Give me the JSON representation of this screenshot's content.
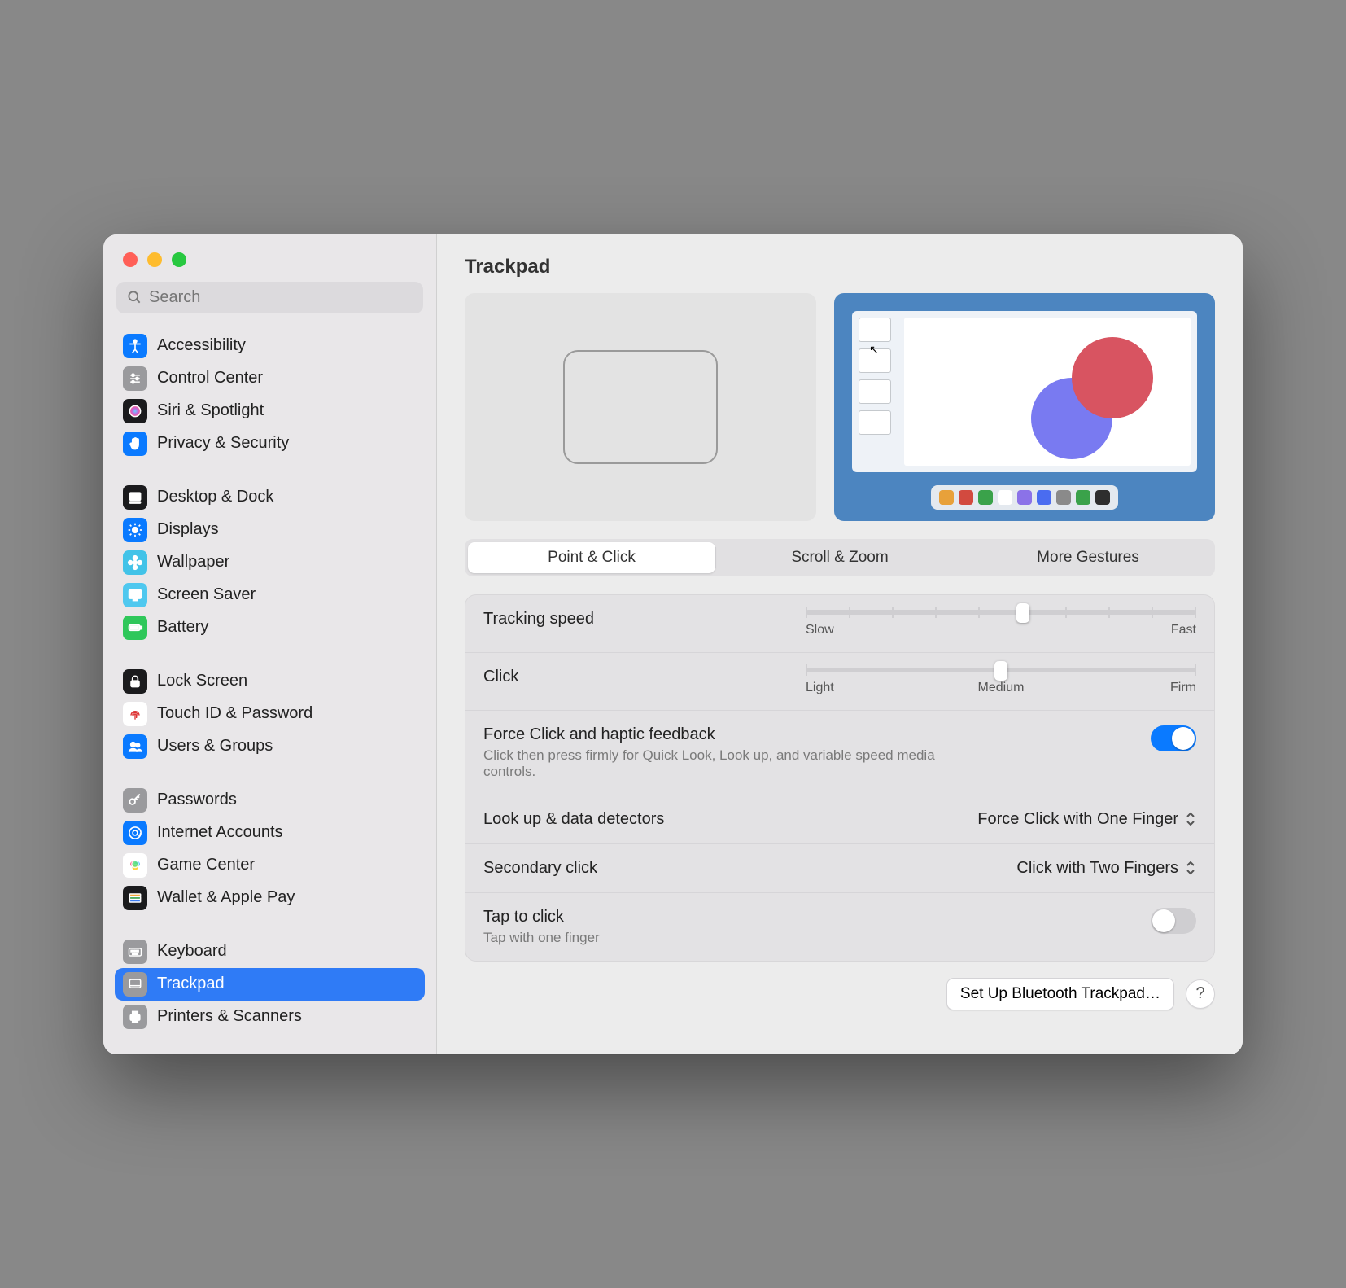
{
  "search": {
    "placeholder": "Search"
  },
  "sidebar": {
    "groups": [
      {
        "items": [
          {
            "label": "Accessibility",
            "icon": "accessibility-icon",
            "bg": "#0a7aff"
          },
          {
            "label": "Control Center",
            "icon": "sliders-icon",
            "bg": "#9a9a9d"
          },
          {
            "label": "Siri & Spotlight",
            "icon": "siri-icon",
            "bg": "#1b1b1d"
          },
          {
            "label": "Privacy & Security",
            "icon": "hand-icon",
            "bg": "#0a7aff"
          }
        ]
      },
      {
        "items": [
          {
            "label": "Desktop & Dock",
            "icon": "dock-icon",
            "bg": "#1b1b1d"
          },
          {
            "label": "Displays",
            "icon": "sun-icon",
            "bg": "#0a7aff"
          },
          {
            "label": "Wallpaper",
            "icon": "flower-icon",
            "bg": "#42c3e8"
          },
          {
            "label": "Screen Saver",
            "icon": "screensaver-icon",
            "bg": "#4fc8ef"
          },
          {
            "label": "Battery",
            "icon": "battery-icon",
            "bg": "#2fc75a"
          }
        ]
      },
      {
        "items": [
          {
            "label": "Lock Screen",
            "icon": "lock-icon",
            "bg": "#1b1b1d"
          },
          {
            "label": "Touch ID & Password",
            "icon": "fingerprint-icon",
            "bg": "#ffffff",
            "fg": "#d33"
          },
          {
            "label": "Users & Groups",
            "icon": "users-icon",
            "bg": "#0a7aff"
          }
        ]
      },
      {
        "items": [
          {
            "label": "Passwords",
            "icon": "key-icon",
            "bg": "#9a9a9d"
          },
          {
            "label": "Internet Accounts",
            "icon": "at-icon",
            "bg": "#0a7aff"
          },
          {
            "label": "Game Center",
            "icon": "gamecenter-icon",
            "bg": "#ffffff"
          },
          {
            "label": "Wallet & Apple Pay",
            "icon": "wallet-icon",
            "bg": "#1b1b1d"
          }
        ]
      },
      {
        "items": [
          {
            "label": "Keyboard",
            "icon": "keyboard-icon",
            "bg": "#9a9a9d"
          },
          {
            "label": "Trackpad",
            "icon": "trackpad-icon",
            "bg": "#9a9a9d",
            "selected": true
          },
          {
            "label": "Printers & Scanners",
            "icon": "printer-icon",
            "bg": "#9a9a9d"
          }
        ]
      }
    ]
  },
  "page": {
    "title": "Trackpad"
  },
  "tabs": [
    {
      "label": "Point & Click",
      "active": true
    },
    {
      "label": "Scroll & Zoom",
      "active": false
    },
    {
      "label": "More Gestures",
      "active": false
    }
  ],
  "tracking": {
    "label": "Tracking speed",
    "min_label": "Slow",
    "max_label": "Fast",
    "ticks": 10,
    "value_index": 5
  },
  "click": {
    "label": "Click",
    "left_label": "Light",
    "mid_label": "Medium",
    "right_label": "Firm",
    "ticks": 3,
    "value_index": 1
  },
  "force_click": {
    "label": "Force Click and haptic feedback",
    "sub": "Click then press firmly for Quick Look, Look up, and variable speed media controls.",
    "on": true
  },
  "lookup": {
    "label": "Look up & data detectors",
    "value": "Force Click with One Finger"
  },
  "secondary": {
    "label": "Secondary click",
    "value": "Click with Two Fingers"
  },
  "tap": {
    "label": "Tap to click",
    "sub": "Tap with one finger",
    "on": false
  },
  "footer": {
    "setup_label": "Set Up Bluetooth Trackpad…",
    "help_label": "?"
  },
  "palette_colors": [
    "#e8a13a",
    "#d24a3f",
    "#3aa24a",
    "#ffffff",
    "#8b72e8",
    "#4a6cf0",
    "#8a8a8a",
    "#3aa24a",
    "#2e2e2e"
  ]
}
